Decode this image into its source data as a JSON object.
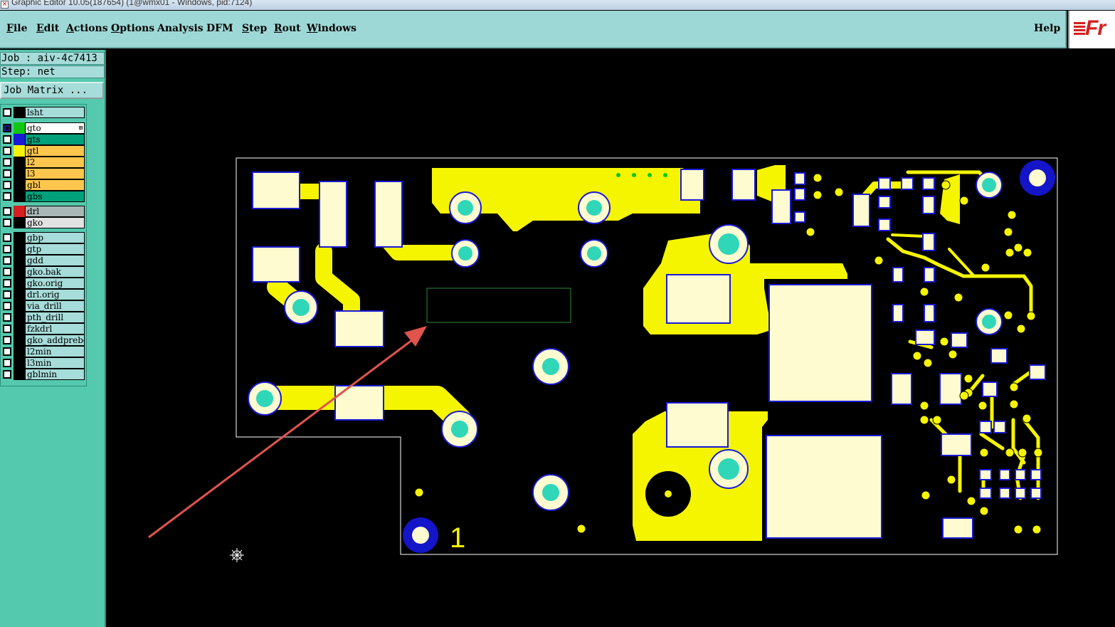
{
  "window": {
    "title": "Graphic Editor 10.05(187654) (1@wmx01 - Windows, pid:7124)"
  },
  "menu": {
    "items": [
      {
        "label": "File",
        "accel": "F",
        "rest": "ile"
      },
      {
        "label": "Edit",
        "accel": "E",
        "rest": "dit"
      },
      {
        "label": "Actions",
        "accel": "A",
        "rest": "ctions"
      },
      {
        "label": "Options",
        "accel": "O",
        "rest": "ptions"
      },
      {
        "label": "Analysis",
        "accel": "",
        "rest": "Analysis"
      },
      {
        "label": "DFM",
        "accel": "",
        "rest": "DFM"
      },
      {
        "label": "Step",
        "accel": "S",
        "rest": "tep"
      },
      {
        "label": "Rout",
        "accel": "R",
        "rest": "out"
      },
      {
        "label": "Windows",
        "accel": "W",
        "rest": "indows"
      }
    ],
    "help": "Help",
    "logo_text": "Fr"
  },
  "panel": {
    "job": "Job : aiv-4c7413",
    "step": "Step: net",
    "job_matrix": "Job Matrix ..."
  },
  "layers": [
    {
      "name": "lsht",
      "color": "#000000",
      "bg": "#a6dcd9",
      "checked": false,
      "active": false
    },
    {
      "name": "gto",
      "color": "#11c711",
      "bg": "#ffffff",
      "checked": true,
      "active": true
    },
    {
      "name": "gts",
      "color": "#1a1ad6",
      "bg": "#00a07a",
      "checked": false,
      "active": false
    },
    {
      "name": "gtl",
      "color": "#f5f500",
      "bg": "#ffc64d",
      "checked": false,
      "active": false
    },
    {
      "name": "l2",
      "color": "#000000",
      "bg": "#ffc64d",
      "checked": false,
      "active": false
    },
    {
      "name": "l3",
      "color": "#000000",
      "bg": "#ffc64d",
      "checked": false,
      "active": false
    },
    {
      "name": "gbl",
      "color": "#000000",
      "bg": "#ffc64d",
      "checked": false,
      "active": false
    },
    {
      "name": "gbs",
      "color": "#000000",
      "bg": "#00a07a",
      "checked": false,
      "active": false
    },
    {
      "name": "drl",
      "color": "#d61f1f",
      "bg": "#a9b7b7",
      "checked": false,
      "active": false
    },
    {
      "name": "gko",
      "color": "#000000",
      "bg": "#e2e2e2",
      "checked": false,
      "active": false
    },
    {
      "name": "gbp",
      "color": "#000000",
      "bg": "#a6dcd9",
      "checked": false,
      "active": false
    },
    {
      "name": "gtp",
      "color": "#000000",
      "bg": "#a6dcd9",
      "checked": false,
      "active": false
    },
    {
      "name": "gdd",
      "color": "#000000",
      "bg": "#a6dcd9",
      "checked": false,
      "active": false
    },
    {
      "name": "gko.bak",
      "color": "#000000",
      "bg": "#a6dcd9",
      "checked": false,
      "active": false
    },
    {
      "name": "gko.orig",
      "color": "#000000",
      "bg": "#a6dcd9",
      "checked": false,
      "active": false
    },
    {
      "name": "drl.orig",
      "color": "#000000",
      "bg": "#a6dcd9",
      "checked": false,
      "active": false
    },
    {
      "name": "via_drill",
      "color": "#000000",
      "bg": "#a6dcd9",
      "checked": false,
      "active": false
    },
    {
      "name": "pth_drill",
      "color": "#000000",
      "bg": "#a6dcd9",
      "checked": false,
      "active": false
    },
    {
      "name": "fzkdrl",
      "color": "#000000",
      "bg": "#a6dcd9",
      "checked": false,
      "active": false
    },
    {
      "name": "gko_addprebe",
      "color": "#000000",
      "bg": "#a6dcd9",
      "checked": false,
      "active": false
    },
    {
      "name": "l2min",
      "color": "#000000",
      "bg": "#a6dcd9",
      "checked": false,
      "active": false
    },
    {
      "name": "l3min",
      "color": "#000000",
      "bg": "#a6dcd9",
      "checked": false,
      "active": false
    },
    {
      "name": "gblmin",
      "color": "#000000",
      "bg": "#a6dcd9",
      "checked": false,
      "active": false
    }
  ],
  "board": {
    "silk_label": "1",
    "colors": {
      "copper": "#f5f500",
      "pad": "#fffbd0",
      "mask_outline": "#1a1ad6",
      "drill": "#2fd6b8",
      "outline": "#ffffff",
      "annotation": "#e0544e",
      "selection_box": "#2e8b3a"
    }
  }
}
